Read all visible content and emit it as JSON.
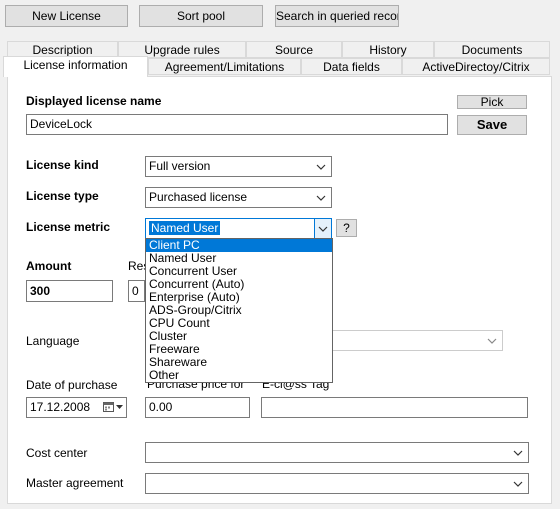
{
  "toolbar": {
    "new_license": "New License",
    "sort_pool": "Sort pool",
    "search_queried": "Search in queried records"
  },
  "tabs_row1": [
    "Description",
    "Upgrade rules",
    "Source",
    "History",
    "Documents"
  ],
  "tabs_row2": [
    "License information",
    "Agreement/Limitations",
    "Data fields",
    "ActiveDirectoy/Citrix"
  ],
  "form": {
    "displayed_name_label": "Displayed license name",
    "pick_button": "Pick",
    "save_button": "Save",
    "displayed_name_value": "DeviceLock",
    "license_kind_label": "License kind",
    "license_kind_value": "Full version",
    "license_type_label": "License type",
    "license_type_value": "Purchased license",
    "license_metric_label": "License metric",
    "license_metric_value": "Named User",
    "help_button": "?",
    "amount_label": "Amount",
    "amount_value": "300",
    "res_label": "Res",
    "res_value": "0",
    "language_label": "Language",
    "date_label": "Date of purchase",
    "date_value": "17.12.2008",
    "purchase_price_label": "Purchase price for",
    "purchase_price_value": "0.00",
    "eclass_label": "E-cl@ss Tag",
    "cost_center_label": "Cost center",
    "master_agreement_label": "Master agreement"
  },
  "metric_options": [
    "Client PC",
    "Named User",
    "Concurrent User",
    "Concurrent (Auto)",
    "Enterprise (Auto)",
    "ADS-Group/Citrix",
    "CPU Count",
    "Cluster",
    "Freeware",
    "Shareware",
    "Other"
  ],
  "colors": {
    "accent": "#0078d7",
    "window_bg": "#f0f0f0",
    "panel_bg": "#ffffff"
  }
}
